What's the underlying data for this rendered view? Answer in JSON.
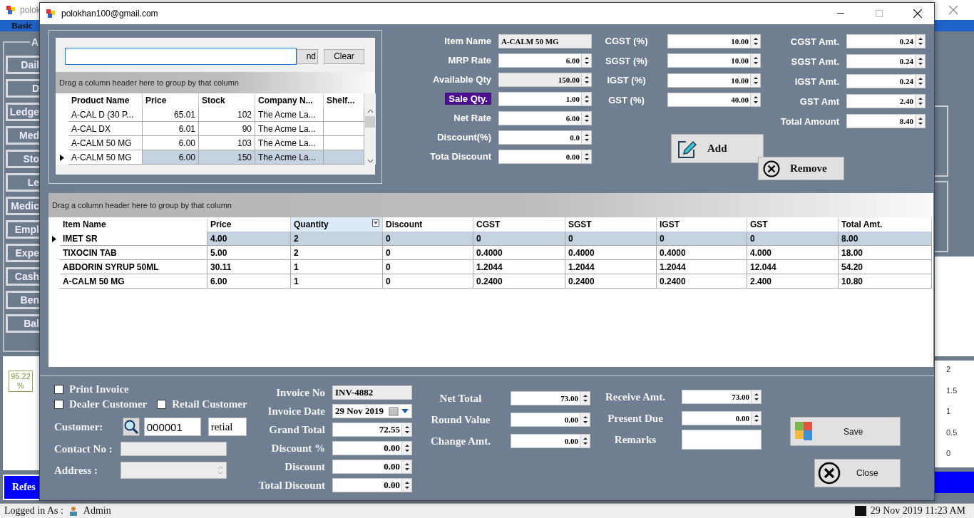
{
  "app": {
    "title": "polok",
    "menu": [
      "Basic"
    ],
    "sidebar_title": "A",
    "sidebar_buttons": [
      "Dail",
      "D",
      "Ledge",
      "Med",
      "Sto",
      "Le",
      "Medic",
      "Empl",
      "Expe",
      "Cash",
      "Ben",
      "Bal"
    ],
    "chart_badge": "95.22 %",
    "axis_labels": [
      "2",
      "1.5",
      "1",
      "0.5",
      "0"
    ],
    "refresh_button": "Refes",
    "status": {
      "user_label": "Logged in As :",
      "user": "Admin",
      "datetime": "29 Nov 2019 11:23 AM"
    }
  },
  "dialog": {
    "title": "polokhan100@gmail.com",
    "search": {
      "find_button": "nd",
      "clear_button": "Clear"
    },
    "product_grid": {
      "group_hint": "Drag a column header here to group by that column",
      "columns": [
        "Product Name",
        "Price",
        "Stock",
        "Company N...",
        "Shelf..."
      ],
      "rows": [
        {
          "cells": [
            "A-CAL D (30 P...",
            "65.01",
            "102",
            "The Acme La...",
            ""
          ],
          "selected": false
        },
        {
          "cells": [
            "A-CAL DX",
            "6.01",
            "90",
            "The Acme La...",
            ""
          ],
          "selected": false
        },
        {
          "cells": [
            "A-CALM 50 MG",
            "6.00",
            "103",
            "The Acme La...",
            ""
          ],
          "selected": false
        },
        {
          "cells": [
            "A-CALM 50 MG",
            "6.00",
            "150",
            "The Acme La...",
            ""
          ],
          "selected": true
        }
      ]
    },
    "item_fields": [
      {
        "label": "Item Name",
        "value": "A-CALM 50 MG",
        "kind": "text",
        "readonly": true,
        "highlighted": false
      },
      {
        "label": "MRP Rate",
        "value": "6.00",
        "kind": "spin",
        "readonly": false,
        "highlighted": false
      },
      {
        "label": "Available Qty",
        "value": "150.00",
        "kind": "spin",
        "readonly": true,
        "highlighted": false
      },
      {
        "label": "Sale Qty.",
        "value": "1.00",
        "kind": "spin",
        "readonly": false,
        "highlighted": true
      },
      {
        "label": "Net Rate",
        "value": "6.00",
        "kind": "spin",
        "readonly": false,
        "highlighted": false
      },
      {
        "label": "Discount(%)",
        "value": "0.0",
        "kind": "spin",
        "readonly": false,
        "highlighted": false
      },
      {
        "label": "Tota Discount",
        "value": "0.00",
        "kind": "spin",
        "readonly": false,
        "highlighted": false
      }
    ],
    "tax_fields": [
      {
        "label": "CGST (%)",
        "value": "10.00",
        "kind": "spin"
      },
      {
        "label": "SGST (%)",
        "value": "10.00",
        "kind": "spin"
      },
      {
        "label": "IGST (%)",
        "value": "10.00",
        "kind": "spin"
      },
      {
        "label": "GST (%)",
        "value": "40.00",
        "kind": "spin"
      }
    ],
    "amount_fields": [
      {
        "label": "CGST Amt.",
        "value": "0.24",
        "kind": "spin"
      },
      {
        "label": "SGST Amt.",
        "value": "0.24",
        "kind": "spin"
      },
      {
        "label": "IGST Amt.",
        "value": "0.24",
        "kind": "spin"
      },
      {
        "label": "GST Amt",
        "value": "2.40",
        "kind": "spin"
      },
      {
        "label": "Total Amount",
        "value": "8.40",
        "kind": "spin"
      }
    ],
    "add_button": "Add",
    "remove_button": "Remove",
    "item_grid": {
      "group_hint": "Drag a column header here to group by that column",
      "columns": [
        {
          "label": "Item Name",
          "filtered": false
        },
        {
          "label": "Price",
          "filtered": false
        },
        {
          "label": "Quantity",
          "filtered": true
        },
        {
          "label": "Discount",
          "filtered": false
        },
        {
          "label": "CGST",
          "filtered": false
        },
        {
          "label": "SGST",
          "filtered": false
        },
        {
          "label": "IGST",
          "filtered": false
        },
        {
          "label": "GST",
          "filtered": false
        },
        {
          "label": "Total Amt.",
          "filtered": false
        }
      ],
      "rows": [
        {
          "cells": [
            "IMET SR",
            "4.00",
            "2",
            "0",
            "0",
            "0",
            "0",
            "0",
            "8.00"
          ],
          "selected": true
        },
        {
          "cells": [
            "TIXOCIN TAB",
            "5.00",
            "2",
            "0",
            "0.4000",
            "0.4000",
            "0.4000",
            "4.000",
            "18.00"
          ],
          "selected": false
        },
        {
          "cells": [
            "ABDORIN SYRUP 50ML",
            "30.11",
            "1",
            "0",
            "1.2044",
            "1.2044",
            "1.2044",
            "12.044",
            "54.20"
          ],
          "selected": false
        },
        {
          "cells": [
            "A-CALM 50 MG",
            "6.00",
            "1",
            "0",
            "0.2400",
            "0.2400",
            "0.2400",
            "2.400",
            "10.80"
          ],
          "selected": false
        }
      ]
    },
    "options": [
      {
        "label": "Print Invoice",
        "checked": false
      },
      {
        "label": "Dealer Customer",
        "checked": false
      },
      {
        "label": "Retail Customer",
        "checked": false
      }
    ],
    "customer": {
      "label": "Customer:",
      "code": "000001",
      "type": "retial"
    },
    "contact": {
      "label": "Contact No :"
    },
    "address": {
      "label": "Address :"
    },
    "invoice_fields": [
      {
        "label": "Invoice No",
        "value": "INV-4882",
        "kind": "text",
        "readonly": true
      },
      {
        "label": "Invoice Date",
        "value": "29 Nov 2019",
        "kind": "date",
        "readonly": false
      },
      {
        "label": "Grand Total",
        "value": "72.55",
        "kind": "spin",
        "readonly": false
      },
      {
        "label": "Discount %",
        "value": "0.00",
        "kind": "spin",
        "readonly": false
      },
      {
        "label": "Discount",
        "value": "0.00",
        "kind": "spin",
        "readonly": false
      },
      {
        "label": "Total Discount",
        "value": "0.00",
        "kind": "spin",
        "readonly": false
      }
    ],
    "total_fields": [
      {
        "label": "Net Total",
        "value": "73.00",
        "kind": "spin"
      },
      {
        "label": "Round Value",
        "value": "0.00",
        "kind": "spin"
      },
      {
        "label": "Change Amt.",
        "value": "0.00",
        "kind": "spin"
      }
    ],
    "payment_fields": [
      {
        "label": "Receive Amt.",
        "value": "73.00",
        "kind": "spin"
      },
      {
        "label": "Present Due",
        "value": "0.00",
        "kind": "spin"
      },
      {
        "label": "Remarks",
        "kind": "text"
      }
    ],
    "save_button": "Save",
    "close_button": "Close"
  }
}
